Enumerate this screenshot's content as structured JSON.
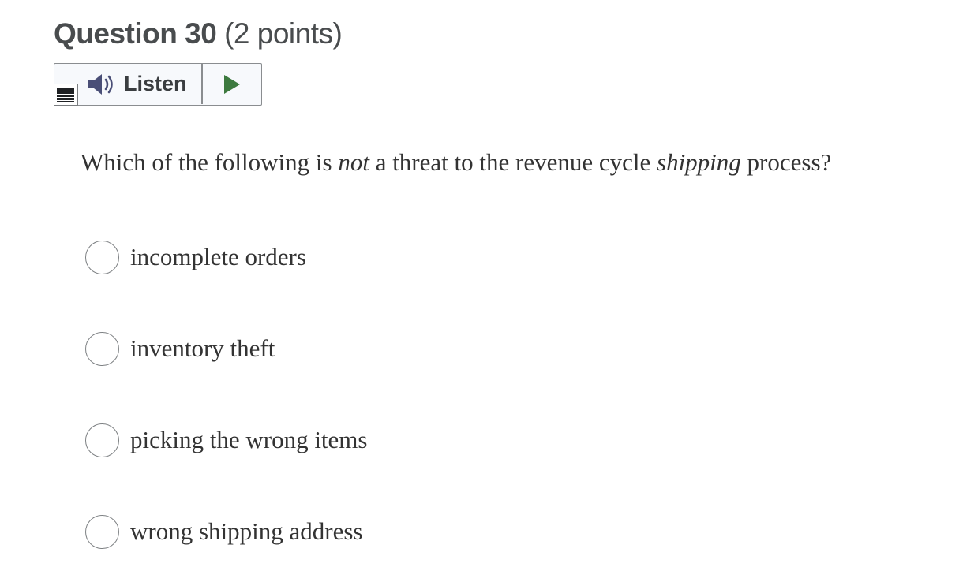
{
  "question": {
    "title": "Question 30",
    "points": "(2 points)",
    "text_parts": [
      "Which of the following is ",
      "not",
      " a threat to the revenue cycle ",
      "shipping",
      " process?"
    ]
  },
  "listen": {
    "label": "Listen",
    "icons": {
      "menu": "menu-icon",
      "speaker": "speaker-icon",
      "play": "play-icon"
    },
    "colors": {
      "speaker": "#4a4f77",
      "play": "#3d7a3f"
    }
  },
  "options": [
    {
      "label": "incomplete orders",
      "selected": false
    },
    {
      "label": "inventory theft",
      "selected": false
    },
    {
      "label": "picking the wrong items",
      "selected": false
    },
    {
      "label": "wrong shipping address",
      "selected": false
    }
  ]
}
